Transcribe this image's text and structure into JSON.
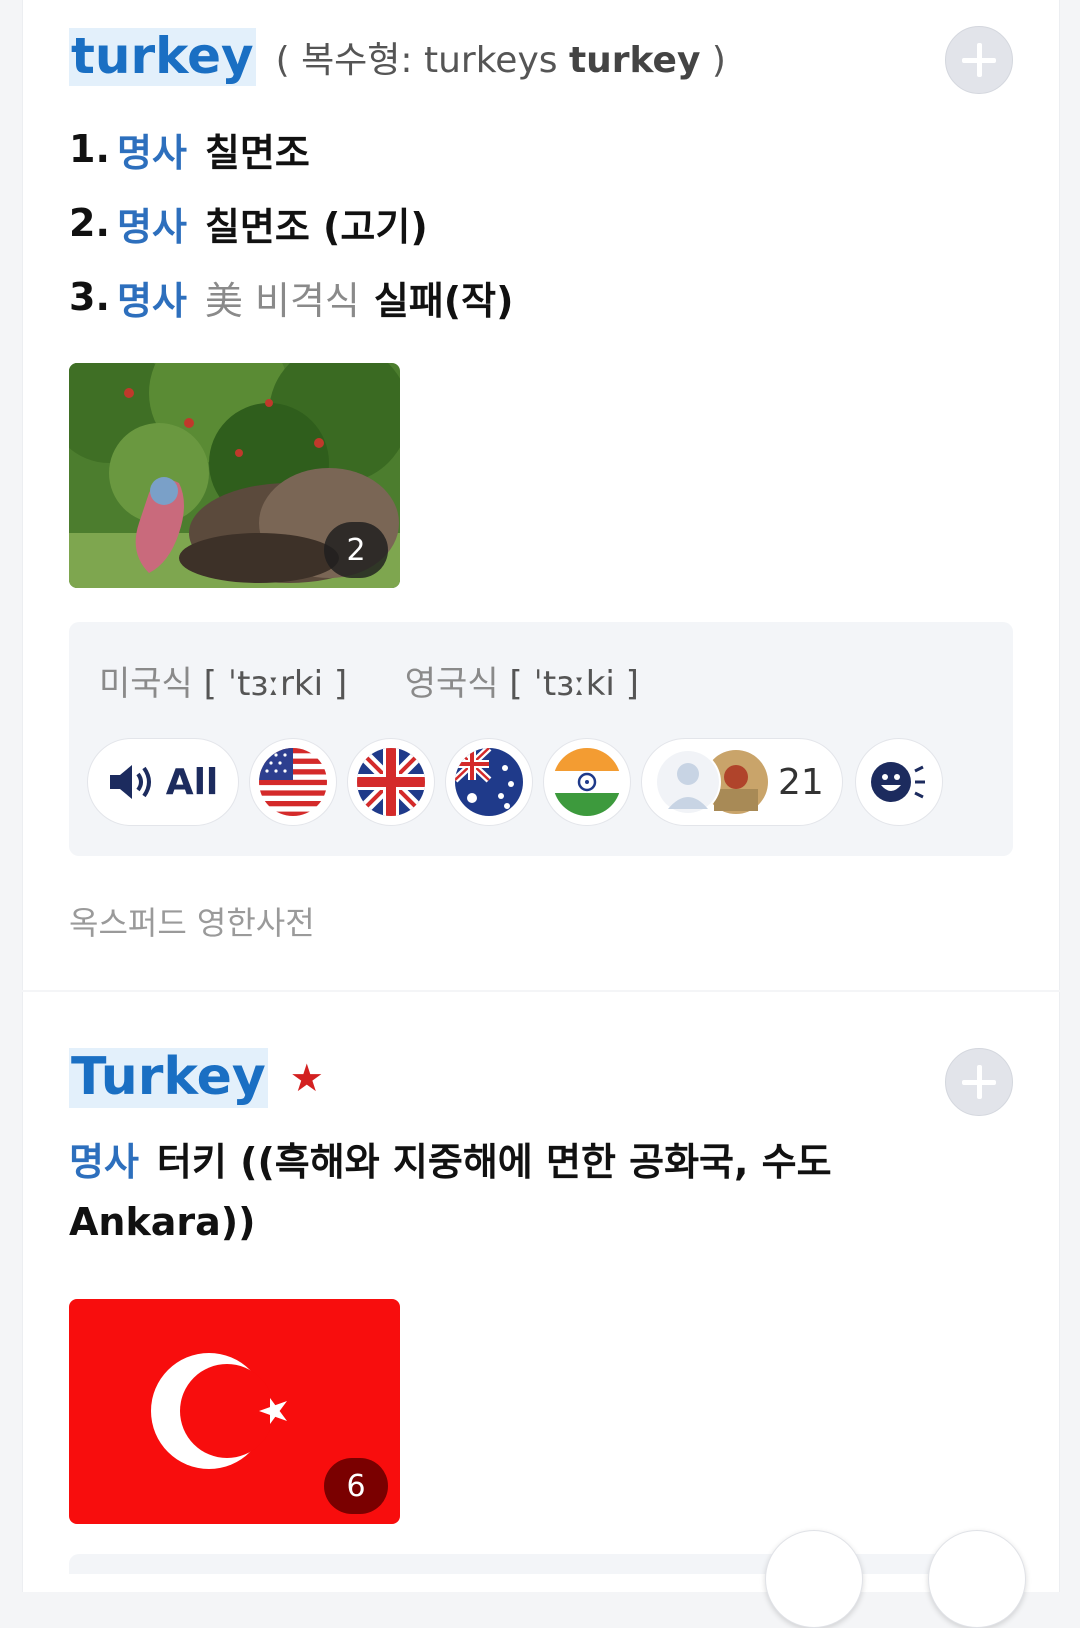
{
  "entry1": {
    "headword": "turkey",
    "plural_prefix": "( 복수형: turkeys",
    "plural_bold": "turkey",
    "plural_suffix": ")",
    "senses": [
      {
        "num": "1.",
        "pos": "명사",
        "usage": "",
        "gloss": "칠면조"
      },
      {
        "num": "2.",
        "pos": "명사",
        "usage": "",
        "gloss": "칠면조 (고기)"
      },
      {
        "num": "3.",
        "pos": "명사",
        "usage": "美 비격식",
        "gloss": "실패(작)"
      }
    ],
    "image_count": "2",
    "pronunciation": {
      "us_label": "미국식",
      "us_ipa": "[ ˈtɜːrki ]",
      "uk_label": "영국식",
      "uk_ipa": "[ ˈtɜːki ]"
    },
    "audio": {
      "all_label": "All",
      "speakers_count": "21",
      "flags": [
        "us-flag-icon",
        "uk-flag-icon",
        "australia-flag-icon",
        "india-flag-icon"
      ]
    },
    "source": "옥스퍼드 영한사전"
  },
  "entry2": {
    "headword": "Turkey",
    "star": "★",
    "pos": "명사",
    "gloss_line": "터키 ((흑해와 지중해에 면한 공화국, 수도 Ankara))",
    "image_count": "6"
  },
  "colors": {
    "accent": "#1a6fc3",
    "pos": "#2d6fbd",
    "star": "#d32020",
    "highlight": "#e3f0fb"
  }
}
